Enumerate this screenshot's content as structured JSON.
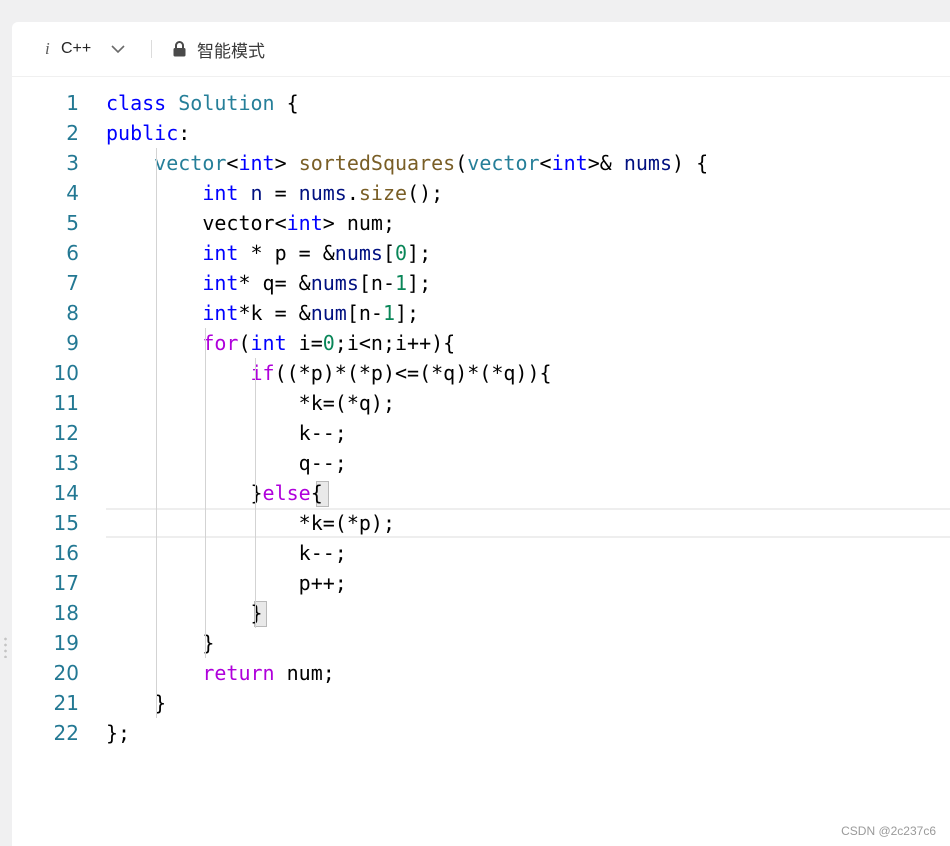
{
  "toolbar": {
    "info_icon": "i",
    "language": "C++",
    "mode": "智能模式"
  },
  "icons": {
    "info": "info-icon",
    "dropdown": "chevron-down-icon",
    "lock": "lock-icon"
  },
  "colors": {
    "line_numbers": "#237893",
    "keyword": "#0000ff",
    "type": "#267f99",
    "function": "#795e26",
    "control": "#af00db",
    "variable": "#001080",
    "number": "#098658"
  },
  "editor": {
    "current_line": 15,
    "lines": [
      [
        [
          "class",
          "kw"
        ],
        [
          " ",
          ""
        ],
        [
          "Solution",
          "ty"
        ],
        [
          " {",
          ""
        ]
      ],
      [
        [
          "public",
          "kw"
        ],
        [
          ":",
          ""
        ]
      ],
      [
        [
          "    ",
          ""
        ],
        [
          "vector",
          "ty"
        ],
        [
          "<",
          ""
        ],
        [
          "int",
          "kw"
        ],
        [
          "> ",
          ""
        ],
        [
          "sortedSquares",
          "fn"
        ],
        [
          "(",
          ""
        ],
        [
          "vector",
          "ty"
        ],
        [
          "<",
          ""
        ],
        [
          "int",
          "kw"
        ],
        [
          ">& ",
          ""
        ],
        [
          "nums",
          "var"
        ],
        [
          ") {",
          ""
        ]
      ],
      [
        [
          "        ",
          ""
        ],
        [
          "int",
          "kw"
        ],
        [
          " ",
          ""
        ],
        [
          "n",
          "var"
        ],
        [
          " = ",
          ""
        ],
        [
          "nums",
          "var"
        ],
        [
          ".",
          ""
        ],
        [
          "size",
          "fn"
        ],
        [
          "();",
          ""
        ]
      ],
      [
        [
          "        ",
          ""
        ],
        [
          "vector<",
          ""
        ],
        [
          "int",
          "kw"
        ],
        [
          "> num;",
          ""
        ]
      ],
      [
        [
          "        ",
          ""
        ],
        [
          "int",
          "kw"
        ],
        [
          " * p = &",
          ""
        ],
        [
          "nums",
          "var"
        ],
        [
          "[",
          ""
        ],
        [
          "0",
          "num"
        ],
        [
          "];",
          ""
        ]
      ],
      [
        [
          "        ",
          ""
        ],
        [
          "int",
          "kw"
        ],
        [
          "* q= &",
          ""
        ],
        [
          "nums",
          "var"
        ],
        [
          "[n-",
          ""
        ],
        [
          "1",
          "num"
        ],
        [
          "];",
          ""
        ]
      ],
      [
        [
          "        ",
          ""
        ],
        [
          "int",
          "kw"
        ],
        [
          "*k = &",
          ""
        ],
        [
          "num",
          "var"
        ],
        [
          "[n-",
          ""
        ],
        [
          "1",
          "num"
        ],
        [
          "];",
          ""
        ]
      ],
      [
        [
          "        ",
          ""
        ],
        [
          "for",
          "ctl"
        ],
        [
          "(",
          ""
        ],
        [
          "int",
          "kw"
        ],
        [
          " i=",
          ""
        ],
        [
          "0",
          "num"
        ],
        [
          ";i<n;i++){",
          ""
        ]
      ],
      [
        [
          "            ",
          ""
        ],
        [
          "if",
          "ctl"
        ],
        [
          "((*p)*(*p)<=(*q)*(*q)){",
          ""
        ]
      ],
      [
        [
          "                ",
          ""
        ],
        [
          "*k=(*q);",
          ""
        ]
      ],
      [
        [
          "                ",
          ""
        ],
        [
          "k--;",
          ""
        ]
      ],
      [
        [
          "                ",
          ""
        ],
        [
          "q--;",
          ""
        ]
      ],
      [
        [
          "            ",
          ""
        ],
        [
          "}",
          ""
        ],
        [
          "else",
          "ctl"
        ],
        [
          "{",
          ""
        ]
      ],
      [
        [
          "                ",
          ""
        ],
        [
          "*k=(*p);",
          ""
        ]
      ],
      [
        [
          "                ",
          ""
        ],
        [
          "k--;",
          ""
        ]
      ],
      [
        [
          "                ",
          ""
        ],
        [
          "p++;",
          ""
        ]
      ],
      [
        [
          "            ",
          ""
        ],
        [
          "}",
          ""
        ]
      ],
      [
        [
          "        ",
          ""
        ],
        [
          "}",
          ""
        ]
      ],
      [
        [
          "        ",
          ""
        ],
        [
          "return",
          "ctl"
        ],
        [
          " num;",
          ""
        ]
      ],
      [
        [
          "    ",
          ""
        ],
        [
          "}",
          ""
        ]
      ],
      [
        [
          "};",
          ""
        ]
      ]
    ]
  },
  "watermark": "CSDN @2c237c6"
}
